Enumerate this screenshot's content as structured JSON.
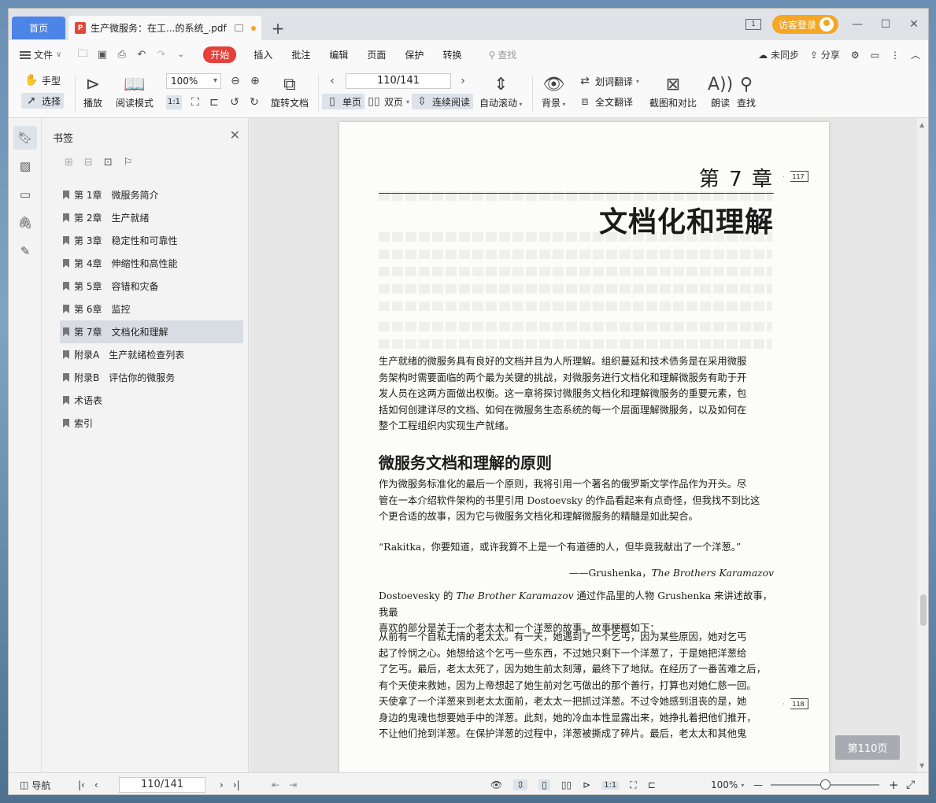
{
  "tabs": {
    "home_label": "首页",
    "doc_title": "生产微服务：在工...的系统_.pdf",
    "add_label": "+"
  },
  "title_right": {
    "badge_text": "1",
    "login_label": "访客登录"
  },
  "menu": {
    "file_label": "文件",
    "items": [
      "开始",
      "插入",
      "批注",
      "编辑",
      "页面",
      "保护",
      "转换"
    ],
    "search_label": "查找",
    "sync_label": "未同步",
    "share_label": "分享"
  },
  "ribbon": {
    "hand_label": "手型",
    "select_label": "选择",
    "play_label": "播放",
    "read_mode_label": "阅读模式",
    "zoom_value": "100%",
    "actual_size_label": "1:1",
    "rotate_doc_label": "旋转文档",
    "page_value": "110/141",
    "single_page_label": "单页",
    "double_page_label": "双页",
    "continuous_label": "连续阅读",
    "auto_scroll_label": "自动滚动",
    "background_label": "背景",
    "word_translate_label": "划词翻译",
    "full_translate_label": "全文翻译",
    "screenshot_compare_label": "截图和对比",
    "read_aloud_label": "朗读",
    "find_label": "查找"
  },
  "bookmarks": {
    "title": "书签",
    "items": [
      {
        "label": "第 1章　微服务简介",
        "selected": false
      },
      {
        "label": "第 2章　生产就绪",
        "selected": false
      },
      {
        "label": "第 3章　稳定性和可靠性",
        "selected": false
      },
      {
        "label": "第 4章　伸缩性和高性能",
        "selected": false
      },
      {
        "label": "第 5章　容错和灾备",
        "selected": false
      },
      {
        "label": "第 6章　监控",
        "selected": false
      },
      {
        "label": "第 7章　文档化和理解",
        "selected": true
      },
      {
        "label": "附录A　生产就绪检查列表",
        "selected": false
      },
      {
        "label": "附录B　评估你的微服务",
        "selected": false
      },
      {
        "label": "术语表",
        "selected": false
      },
      {
        "label": "索引",
        "selected": false
      }
    ]
  },
  "page": {
    "chapter_number": "第 7 章",
    "tag_top": "117",
    "chapter_title": "文档化和理解",
    "intro_lines": [
      "生产就绪的微服务具有良好的文档并且为人所理解。组织蔓延和技术债务是在采用微服",
      "务架构时需要面临的两个最为关键的挑战，对微服务进行文档化和理解微服务有助于开",
      "发人员在这两方面做出权衡。这一章将探讨微服务文档化和理解微服务的重要元素，包",
      "括如何创建详尽的文档、如何在微服务生态系统的每一个层面理解微服务，以及如何在",
      "整个工程组织内实现生产就绪。"
    ],
    "section_title": "微服务文档和理解的原则",
    "section_lines": [
      "作为微服务标准化的最后一个原则，我将引用一个著名的俄罗斯文学作品作为开头。尽",
      "管在一本介绍软件架构的书里引用 Dostoevsky 的作品看起来有点奇怪，但我找不到比这",
      "个更合适的故事，因为它与微服务文档化和理解微服务的精髓是如此契合。"
    ],
    "quote_text": "“Rakitka，你要知道，或许我算不上是一个有道德的人，但毕竟我献出了一个洋葱。”",
    "attrib_prefix": "——Grushenka，",
    "attrib_book": "The Brothers Karamazov",
    "story_intro_a": "Dostoevesky 的 ",
    "story_intro_book": "The Brother Karamazov",
    "story_intro_b": " 通过作品里的人物 Grushenka 来讲述故事，我最",
    "story_intro_line2": "喜欢的部分是关于一个老太太和一个洋葱的故事。故事梗概如下：",
    "story_lines": [
      "从前有一个自私无情的老太太。有一天，她遇到了一个乞丐，因为某些原因，她对乞丐",
      "起了怜悯之心。她想给这个乞丐一些东西，不过她只剩下一个洋葱了，于是她把洋葱给",
      "了乞丐。最后，老太太死了，因为她生前太刻薄，最终下了地狱。在经历了一番苦难之后，",
      "有个天使来救她，因为上帝想起了她生前对乞丐做出的那个善行，打算也对她仁慈一回。",
      "天使拿了一个洋葱来到老太太面前，老太太一把抓过洋葱。不过令她感到沮丧的是，她",
      "身边的鬼魂也想要她手中的洋葱。此刻，她的冷血本性显露出来，她挣扎着把他们推开，",
      "不让他们抢到洋葱。在保护洋葱的过程中，洋葱被撕成了碎片。最后，老太太和其他鬼"
    ],
    "tag_bottom": "118"
  },
  "page_indicator": "第110页",
  "statusbar": {
    "nav_label": "导航",
    "page_value": "110/141",
    "actual_size_label": "1:1",
    "zoom_value": "100%",
    "zoom_fraction": 0.5
  }
}
